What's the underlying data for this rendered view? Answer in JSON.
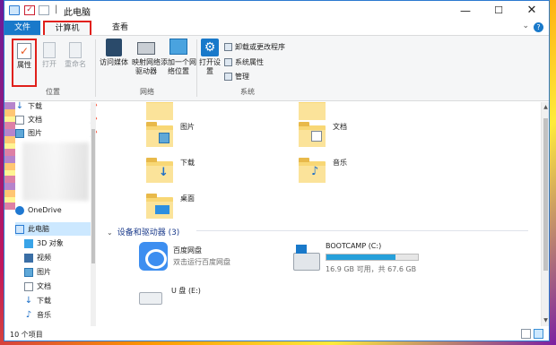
{
  "window": {
    "title": "此电脑"
  },
  "tabs": {
    "file": "文件",
    "computer": "计算机",
    "view": "查看"
  },
  "ribbon": {
    "location": {
      "group_label": "位置",
      "properties": "属性",
      "open": "打开",
      "rename": "重命名"
    },
    "network": {
      "group_label": "网络",
      "access_media": "访问媒体",
      "map_drive": "映射网络驱动器",
      "add_location": "添加一个网络位置"
    },
    "system": {
      "group_label": "系统",
      "open_settings": "打开设置",
      "uninstall": "卸载或更改程序",
      "system_props": "系统属性",
      "manage": "管理"
    }
  },
  "nav": {
    "items": [
      {
        "label": "下载",
        "pinned": true
      },
      {
        "label": "文档",
        "pinned": true
      },
      {
        "label": "图片",
        "pinned": true
      },
      {
        "label": "OneDrive"
      },
      {
        "label": "此电脑"
      },
      {
        "label": "3D 对象"
      },
      {
        "label": "视频"
      },
      {
        "label": "图片"
      },
      {
        "label": "文档"
      },
      {
        "label": "下载"
      },
      {
        "label": "音乐"
      }
    ]
  },
  "folders": [
    {
      "label": "图片"
    },
    {
      "label": "文档"
    },
    {
      "label": "下载"
    },
    {
      "label": "音乐"
    },
    {
      "label": "桌面"
    }
  ],
  "devices": {
    "heading": "设备和驱动器 (3)",
    "baidu": {
      "name": "百度网盘",
      "subtitle": "双击运行百度网盘"
    },
    "bootcamp": {
      "name": "BOOTCAMP (C:)",
      "space": "16.9 GB 可用，共 67.6 GB",
      "used_fraction": 0.75
    },
    "usb": {
      "name": "U 盘 (E:)"
    }
  },
  "status": {
    "count": "10 个项目"
  },
  "colors": {
    "accent": "#1979ca",
    "highlight": "#e0201b",
    "heading": "#1c3c8c"
  }
}
